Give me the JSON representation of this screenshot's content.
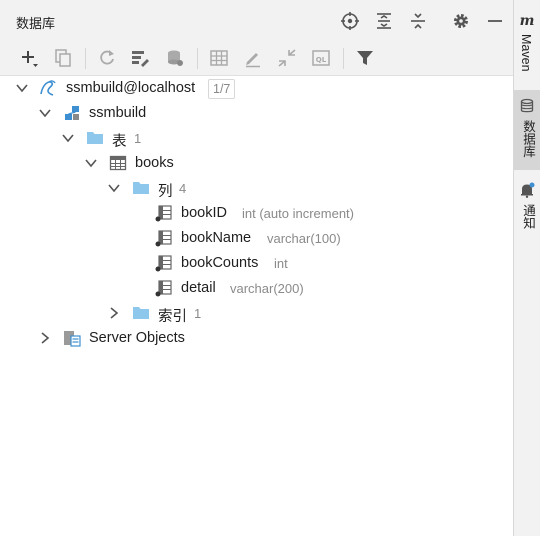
{
  "panel": {
    "title": "数据库"
  },
  "header_icons": [
    "crosshair-icon",
    "expand-all-icon",
    "collapse-all-icon",
    "settings-icon",
    "minimize-icon"
  ],
  "toolbar_icons": [
    "add-icon",
    "copy-icon",
    "refresh-icon",
    "datasource-properties-icon",
    "sync-icon",
    "table-icon",
    "edit-icon",
    "compare-icon",
    "query-console-icon",
    "filter-icon"
  ],
  "tree": {
    "connection": {
      "label": "ssmbuild@localhost",
      "badge": "1/7"
    },
    "schema": {
      "label": "ssmbuild"
    },
    "tables_folder": {
      "label": "表",
      "count": "1"
    },
    "table": {
      "label": "books"
    },
    "columns_folder": {
      "label": "列",
      "count": "4"
    },
    "columns": [
      {
        "name": "bookID",
        "type": "int (auto increment)"
      },
      {
        "name": "bookName",
        "type": "varchar(100)"
      },
      {
        "name": "bookCounts",
        "type": "int"
      },
      {
        "name": "detail",
        "type": "varchar(200)"
      }
    ],
    "index_folder": {
      "label": "索引",
      "count": "1"
    },
    "server_objects": {
      "label": "Server Objects"
    }
  },
  "right_strip": {
    "maven_label": "Maven",
    "database_label": "数据库",
    "notifications_label": "通知"
  },
  "colors": {
    "accent_blue": "#3d8fd1",
    "folder": "#8dc8ec",
    "header_bg": "#f2f2f2",
    "active_strip": "#d6d6d6"
  }
}
